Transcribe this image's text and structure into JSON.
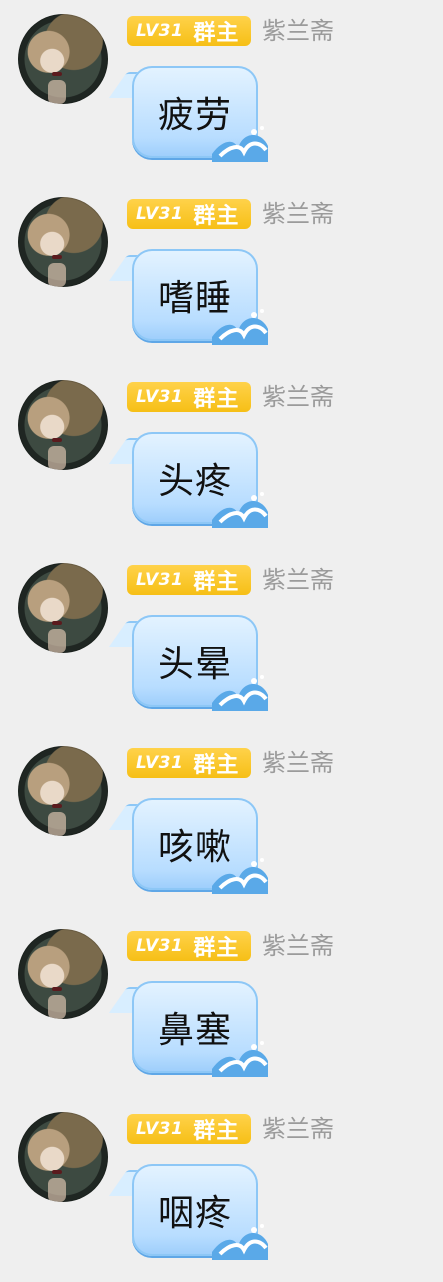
{
  "messages": [
    {
      "level": "LV31",
      "role": "群主",
      "sender": "紫兰斋",
      "text": "疲劳"
    },
    {
      "level": "LV31",
      "role": "群主",
      "sender": "紫兰斋",
      "text": "嗜睡"
    },
    {
      "level": "LV31",
      "role": "群主",
      "sender": "紫兰斋",
      "text": "头疼"
    },
    {
      "level": "LV31",
      "role": "群主",
      "sender": "紫兰斋",
      "text": "头晕"
    },
    {
      "level": "LV31",
      "role": "群主",
      "sender": "紫兰斋",
      "text": "咳嗽"
    },
    {
      "level": "LV31",
      "role": "群主",
      "sender": "紫兰斋",
      "text": "鼻塞"
    },
    {
      "level": "LV31",
      "role": "群主",
      "sender": "紫兰斋",
      "text": "咽疼"
    }
  ],
  "colors": {
    "background": "#efefef",
    "badge": "#f6bf16",
    "bubble": "#b8ddff",
    "name": "#9b9b9b"
  },
  "icons": {
    "avatar": "portrait-photo",
    "bubble_decoration": "wave-icon"
  }
}
